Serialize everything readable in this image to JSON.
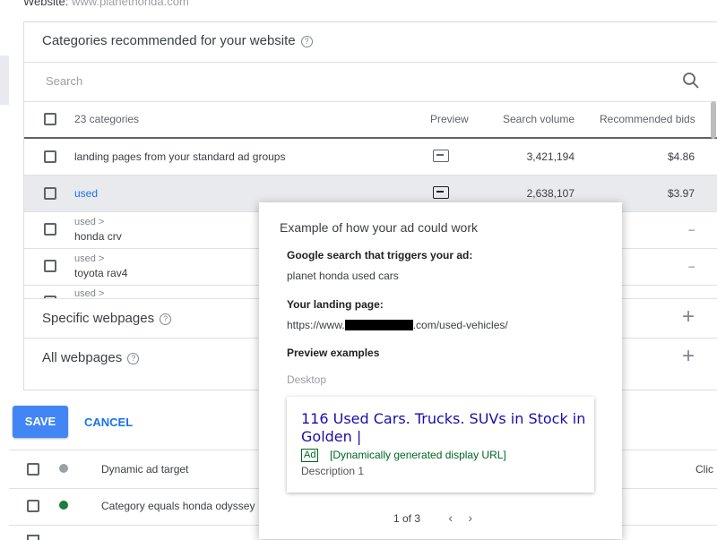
{
  "website": {
    "label": "Website:",
    "value": "www.planethonda.com"
  },
  "card": {
    "title": "Categories recommended for your website",
    "search_placeholder": "Search",
    "header": {
      "count": "23 categories",
      "preview": "Preview",
      "search_volume": "Search volume",
      "recommended_bids": "Recommended bids"
    },
    "rows": [
      {
        "label": "landing pages from your standard ad groups",
        "volume": "3,421,194",
        "bid": "$4.86"
      },
      {
        "label": "used",
        "volume": "2,638,107",
        "bid": "$3.97"
      },
      {
        "parent": "used >",
        "label": "honda crv",
        "bid": "–"
      },
      {
        "parent": "used >",
        "label": "toyota rav4",
        "bid": "–"
      },
      {
        "parent": "used >"
      }
    ],
    "sections": [
      {
        "label": "Specific webpages"
      },
      {
        "label": "All webpages"
      }
    ]
  },
  "actions": {
    "save": "SAVE",
    "cancel": "CANCEL"
  },
  "bottom_table": {
    "header": {
      "target": "Dynamic ad target",
      "clicks": "Clic"
    },
    "rows": [
      {
        "label": "Category equals honda odyssey"
      }
    ]
  },
  "popup": {
    "title": "Example of how your ad could work",
    "search_label": "Google search that triggers your ad:",
    "search_query": "planet honda used cars",
    "landing_label": "Your landing page:",
    "landing_prefix": "https://www.",
    "landing_suffix": ".com/used-vehicles/",
    "preview_label": "Preview examples",
    "device": "Desktop",
    "ad": {
      "headline": "116 Used Cars. Trucks. SUVs in Stock in Golden |",
      "badge": "Ad",
      "display_url": "[Dynamically generated display URL]",
      "description": "Description 1"
    },
    "pager": "1 of 3"
  },
  "colors": {
    "accent": "#4285f4",
    "link": "#1a73e8",
    "ad_headline": "#1a0dab",
    "ad_url": "#006621",
    "status_green": "#188038"
  }
}
